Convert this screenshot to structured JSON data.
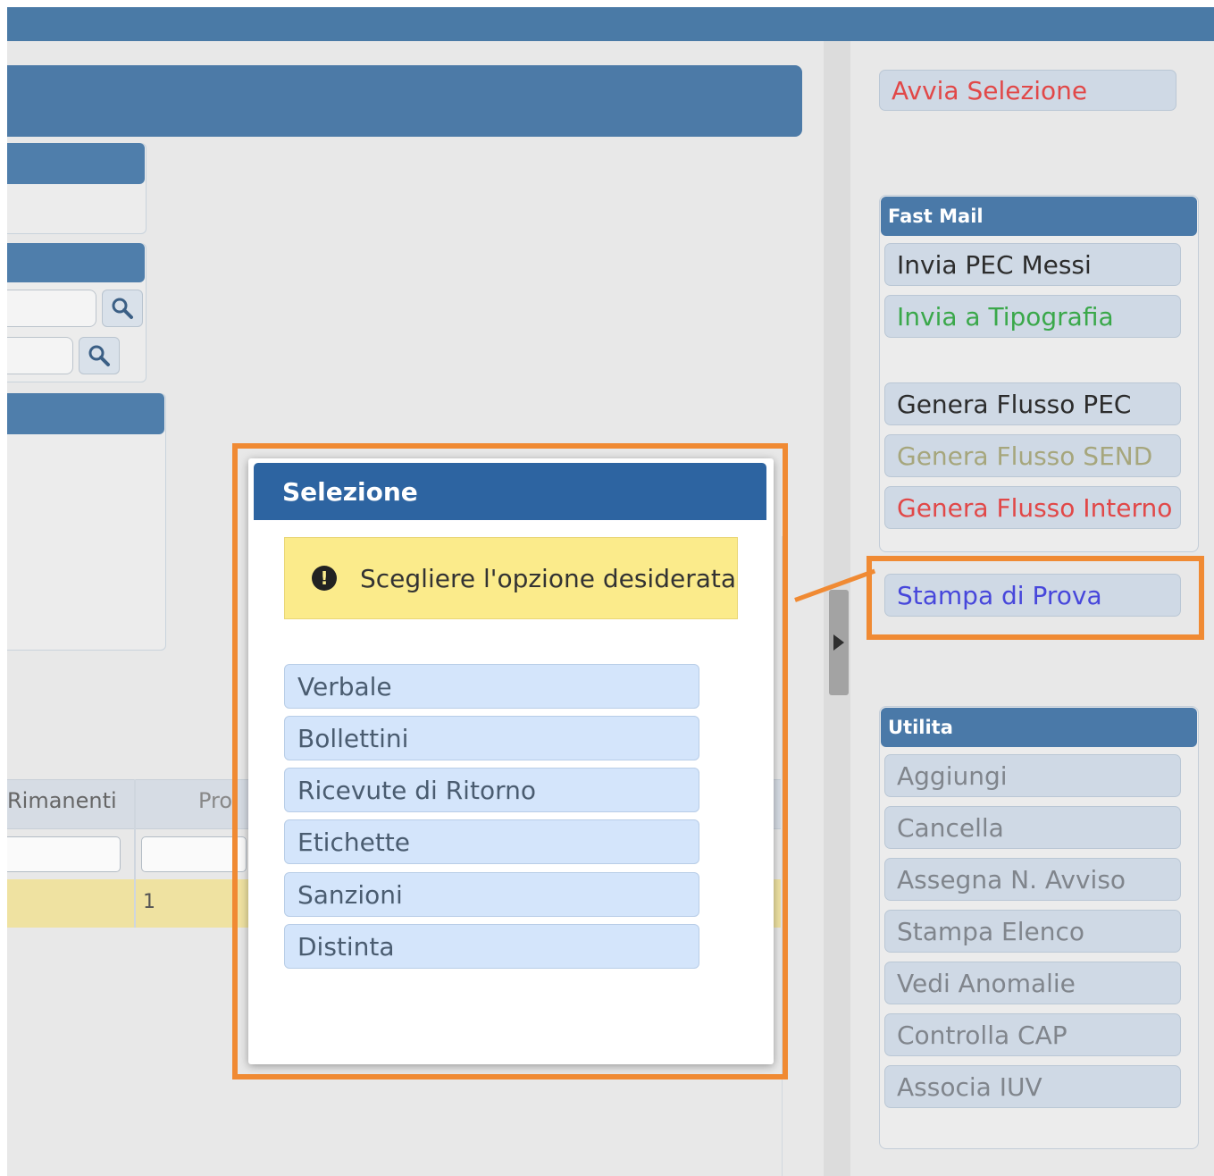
{
  "grid": {
    "col_rimanenti": "Rimanenti",
    "col_pro": "Pro",
    "row1_cell": "1"
  },
  "sidebar": {
    "avvia_selezione": "Avvia Selezione",
    "fast_mail": {
      "title": "Fast Mail",
      "buttons": [
        "Invia PEC Messi",
        "Invia a Tipografia",
        "Genera Flusso PEC",
        "Genera Flusso SEND",
        "Genera Flusso Interno",
        "Stampa di Prova"
      ]
    },
    "utilita": {
      "title": "Utilita",
      "buttons": [
        "Aggiungi",
        "Cancella",
        "Assegna N. Avviso",
        "Stampa Elenco",
        "Vedi Anomalie",
        "Controlla CAP",
        "Associa IUV"
      ]
    }
  },
  "dialog": {
    "title": "Selezione",
    "message": "Scegliere l'opzione desiderata",
    "options": [
      "Verbale",
      "Bollettini",
      "Ricevute di Ritorno",
      "Etichette",
      "Sanzioni",
      "Distinta"
    ]
  },
  "colors": {
    "header_blue": "#4a7aa6",
    "dialog_title_blue": "#2d64a1",
    "highlight_orange": "#f08a33",
    "warning_yellow": "#fbeb8b",
    "text_red": "#e14848",
    "text_green": "#3aa84a",
    "text_blue": "#4747db"
  }
}
